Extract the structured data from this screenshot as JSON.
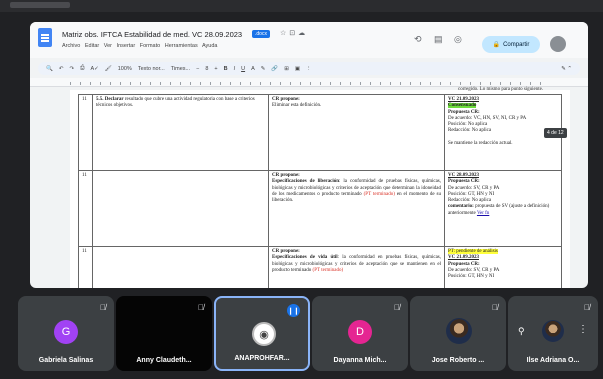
{
  "doc": {
    "title": "Matriz obs. IFTCA Estabilidad de med. VC 28.09.2023",
    "badge": ".docx",
    "menu": "Archivo  Editar  Ver  Insertar  Formato  Herramientas  Ayuda",
    "share_label": "Compartir",
    "toolbar_zoom": "100%",
    "toolbar_style": "Texto nor...",
    "toolbar_font": "Times...",
    "toolbar_size": "8",
    "page_tag": "4 de 12",
    "top_header_fragment": "corregido. Lo mismo para punto siguiente.",
    "rows": [
      {
        "num": "11",
        "c2_bold": "5.5. Declarar",
        "c2_text": " resultado que cubre una actividad regulatoria con base a criterios técnicos objetivos.",
        "c3_bold": "CR propone:",
        "c3_text": "Eliminar esta definición.",
        "c4_date": "VC 21.09.2023",
        "c4_highlight": "Consensuado",
        "c4_prop": "Propuesta CR:",
        "c4_lines": [
          "De acuerdo: VC, HN, SV, NI, CR y PA",
          "Posición: No aplica",
          "Redacción: No aplica",
          "",
          "Se mantiene la redacción actual."
        ]
      },
      {
        "num": "11",
        "c2_bold": "",
        "c2_text": "",
        "c3_bold": "CR propone:",
        "c3_strong": "Especificaciones de liberación",
        "c3_text": ": la conformidad de pruebas físicas, químicas, biológicas y microbiológicas y criterios de aceptación que determinan la idoneidad de los medicamentos o producto terminado ",
        "c3_red": "(PT terminado)",
        "c3_tail": " en el momento de su liberación.",
        "c4_date": "VC 28.09.2023",
        "c4_prop": "Propuesta CR:",
        "c4_lines": [
          "De acuerdo: SV, CR y PA",
          "Posición: GT, HN y NI",
          "Redacción: No aplica"
        ],
        "c4_comment_label": "comentario:",
        "c4_comment": " propuesta de SV (ajuste a definición) anteriormente ",
        "c4_link": "Ver fn"
      },
      {
        "num": "11",
        "c2_bold": "",
        "c2_text": "",
        "c3_bold": "CR propone:",
        "c3_strong": "Especificaciones de vida útil",
        "c3_text": ": la conformidad en pruebas físicas, químicas, biológicas y microbiológicas y criterios de aceptación que se mantienen en el producto terminado ",
        "c3_red": "(PT terminado)",
        "c3_tail": "",
        "c4_top": "PT: pendiente de análisis",
        "c4_date": "VC 21.09.2023",
        "c4_prop": "Propuesta CR:",
        "c4_lines": [
          "De acuerdo: SV, CR y PA",
          "Posición: GT, HN y NI"
        ]
      }
    ]
  },
  "participants": [
    {
      "name": "Gabriela Salinas",
      "initial": "G",
      "color": "#a142f4",
      "type": "avatar"
    },
    {
      "name": "Anny Claudeth...",
      "initial": "",
      "color": "#050505",
      "type": "dark"
    },
    {
      "name": "ANAPROHFAR...",
      "initial": "",
      "color": "#ffffff",
      "type": "logo"
    },
    {
      "name": "Dayanna Mich...",
      "initial": "D",
      "color": "#e52592",
      "type": "avatar"
    },
    {
      "name": "Jose Roberto ...",
      "initial": "",
      "color": "#1f2d4a",
      "type": "photo"
    },
    {
      "name": "Ilse Adriana O...",
      "initial": "",
      "color": "#1f2d4a",
      "type": "photo"
    }
  ]
}
